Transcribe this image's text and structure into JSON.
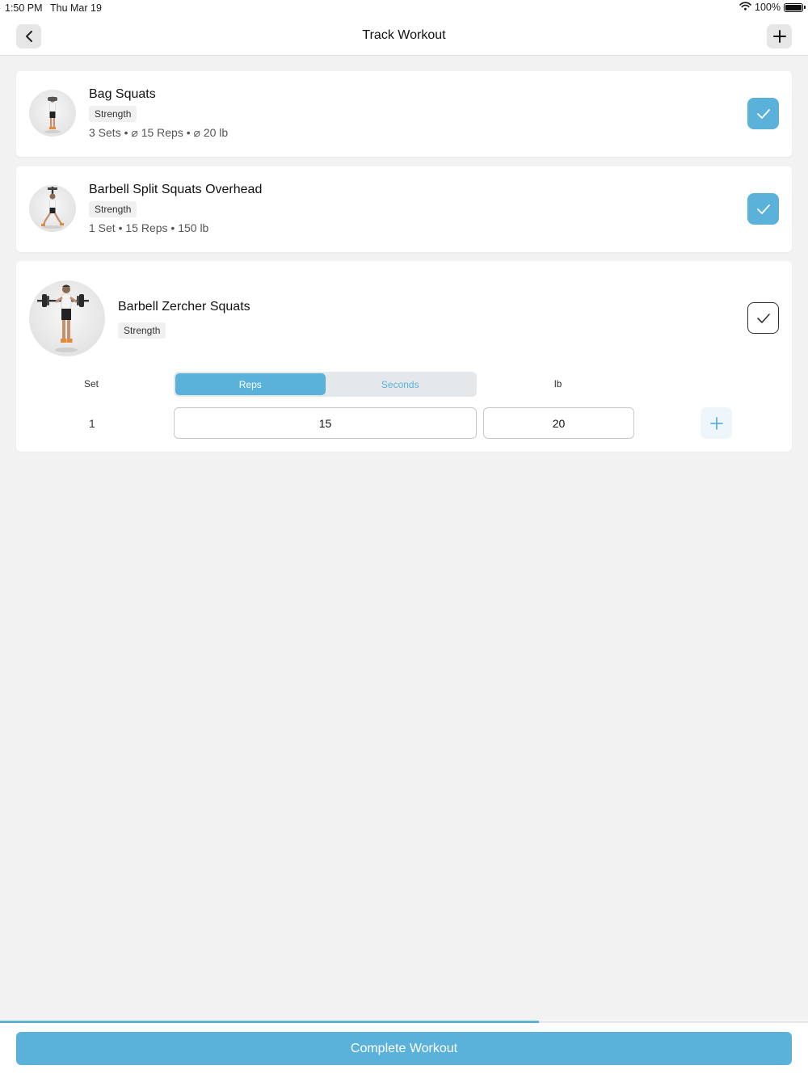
{
  "status_bar": {
    "time": "1:50 PM",
    "date": "Thu Mar 19",
    "battery": "100%"
  },
  "nav": {
    "title": "Track Workout",
    "back_icon": "chevron-left-icon",
    "add_icon": "plus-icon"
  },
  "exercises": [
    {
      "name": "Bag Squats",
      "tag": "Strength",
      "summary": "3 Sets • ⌀ 15 Reps • ⌀ 20 lb",
      "completed": true
    },
    {
      "name": "Barbell Split Squats Overhead",
      "tag": "Strength",
      "summary": "1 Set • 15 Reps • 150 lb",
      "completed": true
    },
    {
      "name": "Barbell Zercher Squats",
      "tag": "Strength",
      "completed": false,
      "headers": {
        "set": "Set",
        "weight_unit": "lb"
      },
      "mode_options": [
        "Reps",
        "Seconds"
      ],
      "selected_mode": "Reps",
      "sets": [
        {
          "number": "1",
          "reps": "15",
          "weight": "20"
        }
      ]
    }
  ],
  "footer": {
    "progress": 0.667,
    "complete_label": "Complete Workout"
  },
  "colors": {
    "accent": "#5ab2db",
    "background": "#f2f2f2"
  }
}
